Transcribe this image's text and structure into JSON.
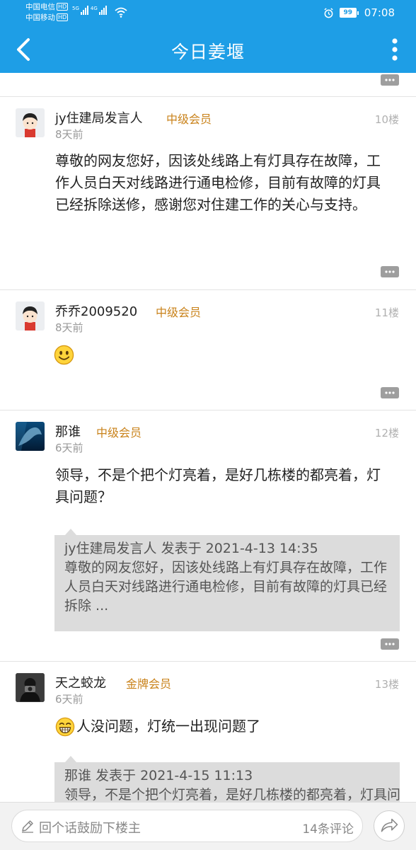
{
  "status_bar": {
    "carrier1": "中国电信",
    "carrier2": "中国移动",
    "hd": "HD",
    "net1": "5G",
    "net2": "4G",
    "battery": "99",
    "time": "07:08"
  },
  "header": {
    "title": "今日姜堰"
  },
  "posts": [
    {
      "user": "jy住建局发言人",
      "badge": "中级会员",
      "time": "8天前",
      "floor": "10楼",
      "content": "尊敬的网友您好，因该处线路上有灯具存在故障，工作人员白天对线路进行通电检修，目前有故障的灯具已经拆除送修，感谢您对住建工作的关心与支持。"
    },
    {
      "user": "乔乔2009520",
      "badge": "中级会员",
      "time": "8天前",
      "floor": "11楼",
      "content": ""
    },
    {
      "user": "那谁",
      "badge": "中级会员",
      "time": "6天前",
      "floor": "12楼",
      "content": "领导，不是个把个灯亮着，是好几栋楼的都亮着，灯具问题？",
      "quote_head": "jy住建局发言人 发表于 2021-4-13 14:35",
      "quote_body": "尊敬的网友您好，因该处线路上有灯具存在故障，工作人员白天对线路进行通电检修，目前有故障的灯具已经拆除 ..."
    },
    {
      "user": "天之蛟龙",
      "badge": "金牌会员",
      "time": "6天前",
      "floor": "13楼",
      "content": "人没问题，灯统一出现问题了",
      "quote_head": "那谁 发表于 2021-4-15 11:13",
      "quote_body": "领导，不是个把个灯亮着，是好几栋楼的都亮着，灯具问题？"
    }
  ],
  "bottom_bar": {
    "placeholder": "回个话鼓励下楼主",
    "comment_count": "14条评论"
  },
  "icons": {
    "back": "chevron-left-icon",
    "more": "more-vertical-icon",
    "reply": "comment-bubble-icon",
    "share": "share-arrow-icon",
    "pencil": "pencil-icon",
    "smile": "smile-emoji",
    "grin": "grin-emoji"
  },
  "colors": {
    "header_bg": "#1e9ee6",
    "badge": "#c9821a",
    "quote_bg": "#dcdcdc"
  }
}
